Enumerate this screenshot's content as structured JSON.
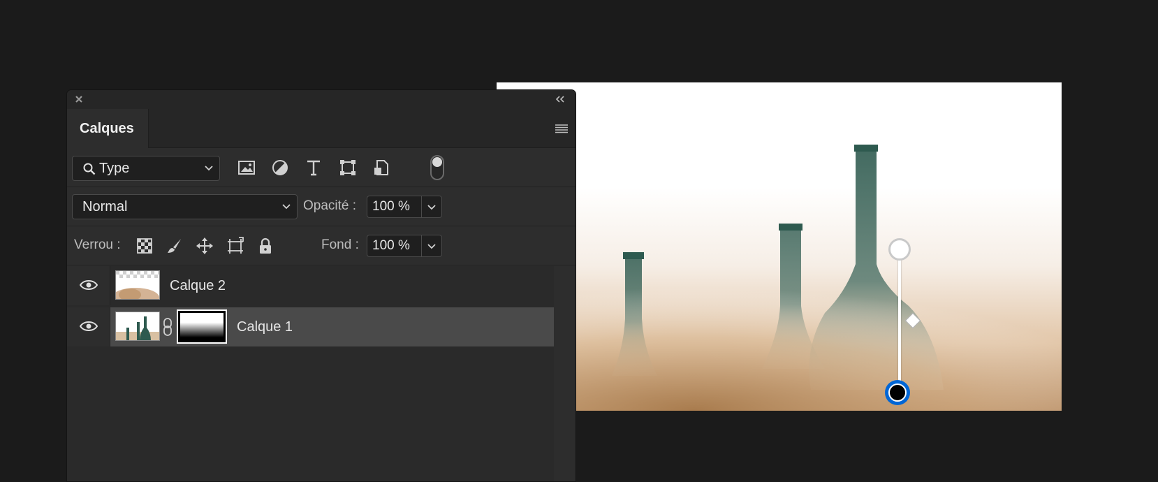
{
  "panel": {
    "tab_title": "Calques",
    "filter": {
      "selected": "Type",
      "icons": [
        "image-filter-icon",
        "adjustment-filter-icon",
        "type-filter-icon",
        "shape-filter-icon",
        "smart-object-filter-icon",
        "filter-toggle"
      ]
    },
    "blend_mode": "Normal",
    "opacity_label": "Opacité :",
    "opacity_value": "100 %",
    "lock_label": "Verrou :",
    "lock_icons": [
      "lock-transparency-icon",
      "lock-pixels-icon",
      "lock-position-icon",
      "lock-artboard-icon",
      "lock-all-icon"
    ],
    "fill_label": "Fond :",
    "fill_value": "100 %",
    "layers": [
      {
        "name": "Calque 2",
        "visible": true,
        "selected": false,
        "has_mask": false
      },
      {
        "name": "Calque 1",
        "visible": true,
        "selected": true,
        "has_mask": true
      }
    ]
  },
  "canvas": {
    "gradient_tool": {
      "start_color": "#ffffff",
      "end_color": "#000000",
      "active_handle_color": "#0066d6"
    }
  },
  "colors": {
    "background": "#1b1b1b",
    "panel": "#2d2d2d",
    "selected_row": "#4a4a4a",
    "accent": "#0066d6"
  }
}
